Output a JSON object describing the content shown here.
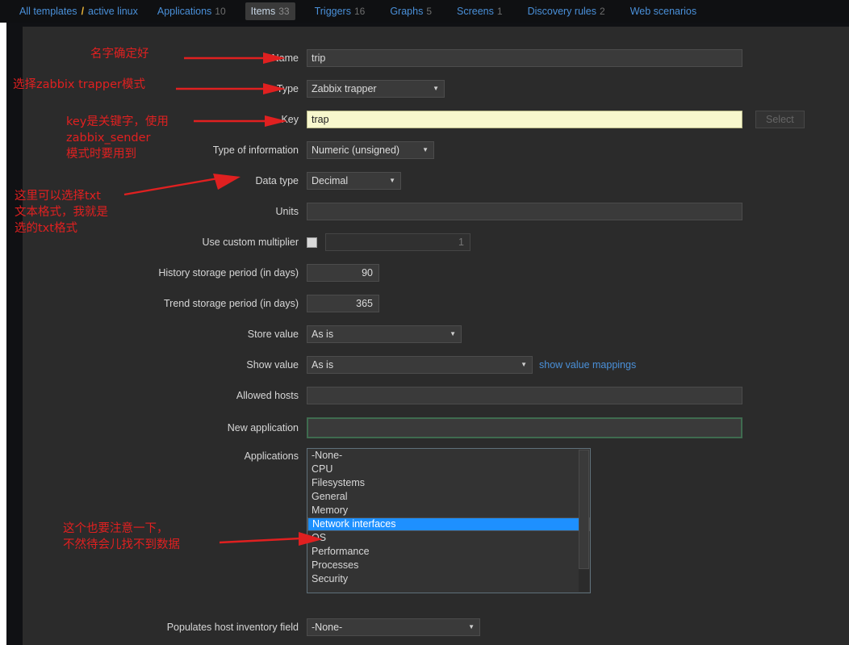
{
  "topbar": {
    "breadcrumb": {
      "root": "All templates",
      "separator": "/",
      "current": "active linux"
    },
    "tabs": [
      {
        "label": "Applications",
        "count": "10",
        "selected": false
      },
      {
        "label": "Items",
        "count": "33",
        "selected": true
      },
      {
        "label": "Triggers",
        "count": "16",
        "selected": false
      },
      {
        "label": "Graphs",
        "count": "5",
        "selected": false
      },
      {
        "label": "Screens",
        "count": "1",
        "selected": false
      },
      {
        "label": "Discovery rules",
        "count": "2",
        "selected": false
      },
      {
        "label": "Web scenarios",
        "count": "",
        "selected": false
      }
    ]
  },
  "form": {
    "name": {
      "label": "Name",
      "value": "trip"
    },
    "type": {
      "label": "Type",
      "value": "Zabbix trapper"
    },
    "key": {
      "label": "Key",
      "value": "trap",
      "button": "Select"
    },
    "type_of_information": {
      "label": "Type of information",
      "value": "Numeric (unsigned)"
    },
    "data_type": {
      "label": "Data type",
      "value": "Decimal"
    },
    "units": {
      "label": "Units",
      "value": ""
    },
    "use_custom_multiplier": {
      "label": "Use custom multiplier",
      "checked": false,
      "value": "",
      "placeholder": "1"
    },
    "history_storage_period": {
      "label": "History storage period (in days)",
      "value": "90"
    },
    "trend_storage_period": {
      "label": "Trend storage period (in days)",
      "value": "365"
    },
    "store_value": {
      "label": "Store value",
      "value": "As is"
    },
    "show_value": {
      "label": "Show value",
      "value": "As is",
      "link": "show value mappings"
    },
    "allowed_hosts": {
      "label": "Allowed hosts",
      "value": ""
    },
    "new_application": {
      "label": "New application",
      "value": ""
    },
    "applications": {
      "label": "Applications",
      "options": [
        {
          "label": "-None-",
          "selected": false
        },
        {
          "label": "CPU",
          "selected": false
        },
        {
          "label": "Filesystems",
          "selected": false
        },
        {
          "label": "General",
          "selected": false
        },
        {
          "label": "Memory",
          "selected": false
        },
        {
          "label": "Network interfaces",
          "selected": true
        },
        {
          "label": "OS",
          "selected": false
        },
        {
          "label": "Performance",
          "selected": false
        },
        {
          "label": "Processes",
          "selected": false
        },
        {
          "label": "Security",
          "selected": false
        }
      ]
    },
    "populates_host_inventory_field": {
      "label": "Populates host inventory field",
      "value": "-None-"
    }
  },
  "annotations": [
    {
      "text": "名字确定好"
    },
    {
      "text": "选择zabbix trapper模式"
    },
    {
      "text": "key是关键字，使用\nzabbix_sender\n模式时要用到"
    },
    {
      "text": "这里可以选择txt\n文本格式，我就是\n选的txt格式"
    },
    {
      "text": "这个也要注意一下，\n不然待会儿找不到数据"
    }
  ],
  "colors": {
    "accent_link": "#4a90d9",
    "breadcrumb_separator": "#e8b339",
    "annotation": "#e02020",
    "list_selection": "#1e90ff",
    "autofill_field": "#f7f7cd",
    "panel_background": "#2b2b2b",
    "topbar_background": "#0f1012",
    "focus_border": "#3f6b4f"
  }
}
